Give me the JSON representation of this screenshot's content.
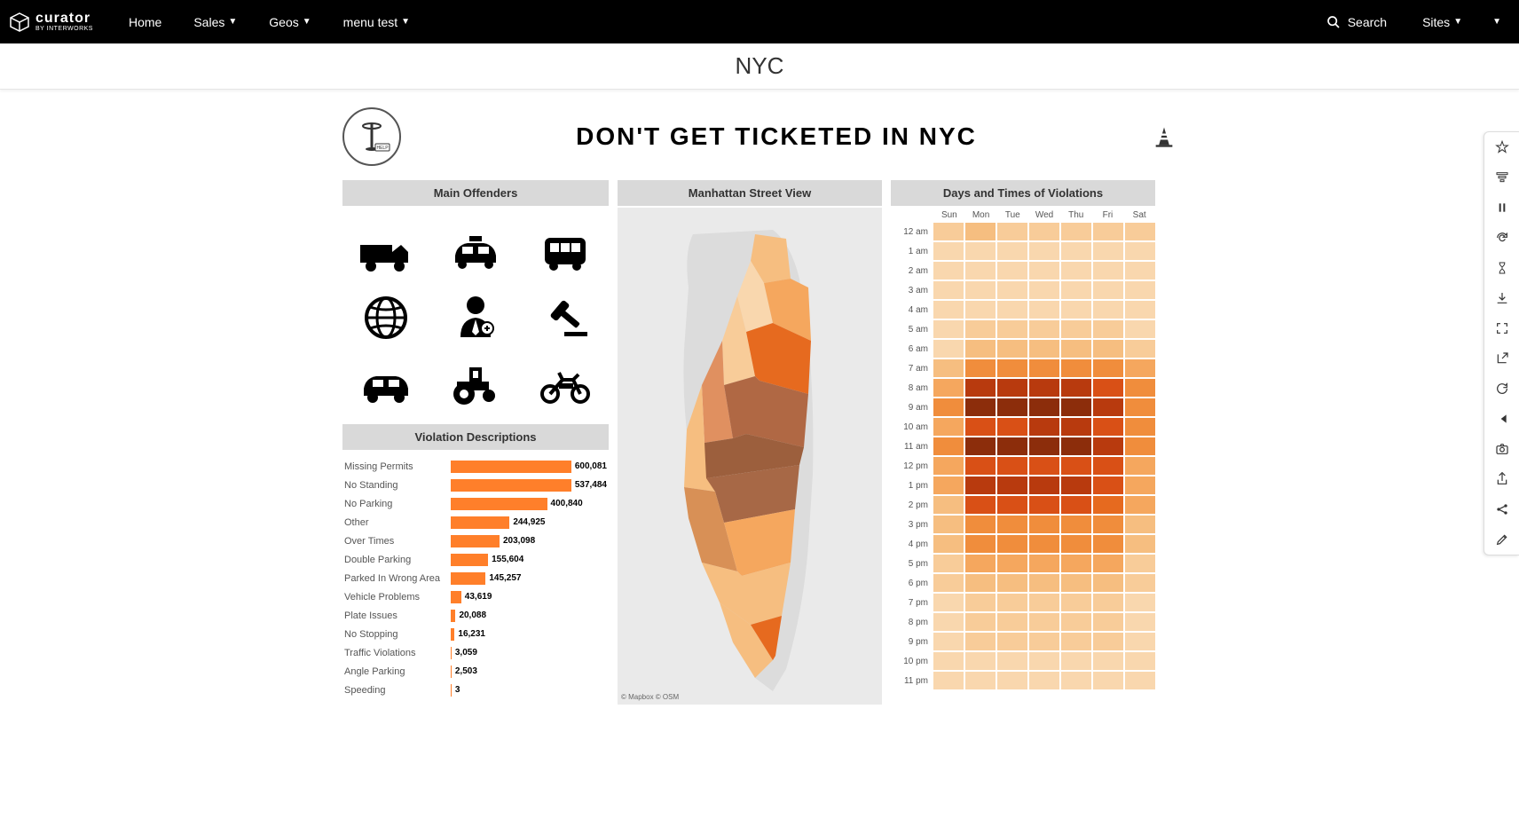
{
  "nav": {
    "brand_main": "curator",
    "brand_sub": "BY INTERWORKS",
    "items": [
      "Home",
      "Sales",
      "Geos",
      "menu test"
    ],
    "items_dropdown": [
      false,
      true,
      true,
      true
    ],
    "search_label": "Search",
    "sites_label": "Sites"
  },
  "page_title": "NYC",
  "dash_title": "DON'T GET TICKETED IN NYC",
  "panels": {
    "offenders": "Main Offenders",
    "map": "Manhattan Street View",
    "heatmap": "Days and Times of Violations",
    "violations": "Violation Descriptions"
  },
  "offenders": [
    "truck",
    "taxi",
    "bus",
    "globe",
    "official",
    "gavel",
    "car",
    "tractor",
    "motorcycle"
  ],
  "map_attrib": "© Mapbox  © OSM",
  "chart_data": {
    "violations_bar": {
      "type": "bar",
      "title": "Violation Descriptions",
      "xlabel": "",
      "ylabel": "",
      "categories": [
        "Missing Permits",
        "No Standing",
        "No Parking",
        "Other",
        "Over Times",
        "Double Parking",
        "Parked In Wrong Area",
        "Vehicle Problems",
        "Plate Issues",
        "No Stopping",
        "Traffic Violations",
        "Angle Parking",
        "Speeding"
      ],
      "values": [
        600081,
        537484,
        400840,
        244925,
        203098,
        155604,
        145257,
        43619,
        20088,
        16231,
        3059,
        2503,
        3
      ],
      "value_labels": [
        "600,081",
        "537,484",
        "400,840",
        "244,925",
        "203,098",
        "155,604",
        "145,257",
        "43,619",
        "20,088",
        "16,231",
        "3,059",
        "2,503",
        "3"
      ],
      "xmax": 650000
    },
    "heatmap": {
      "type": "heatmap",
      "title": "Days and Times of Violations",
      "days": [
        "Sun",
        "Mon",
        "Tue",
        "Wed",
        "Thu",
        "Fri",
        "Sat"
      ],
      "hours": [
        "12 am",
        "1 am",
        "2 am",
        "3 am",
        "4 am",
        "5 am",
        "6 am",
        "7 am",
        "8 am",
        "9 am",
        "10 am",
        "11 am",
        "12 pm",
        "1 pm",
        "2 pm",
        "3 pm",
        "4 pm",
        "5 pm",
        "6 pm",
        "7 pm",
        "8 pm",
        "9 pm",
        "10 pm",
        "11 pm"
      ],
      "intensity": [
        [
          3,
          4,
          3,
          3,
          3,
          3,
          3
        ],
        [
          2,
          2,
          2,
          2,
          2,
          2,
          2
        ],
        [
          2,
          2,
          2,
          2,
          2,
          2,
          2
        ],
        [
          2,
          2,
          2,
          2,
          2,
          2,
          2
        ],
        [
          2,
          2,
          2,
          2,
          2,
          2,
          2
        ],
        [
          2,
          3,
          3,
          3,
          3,
          3,
          2
        ],
        [
          2,
          4,
          4,
          4,
          4,
          4,
          3
        ],
        [
          4,
          6,
          6,
          6,
          6,
          6,
          5
        ],
        [
          5,
          9,
          9,
          9,
          9,
          8,
          6
        ],
        [
          6,
          10,
          10,
          10,
          10,
          9,
          6
        ],
        [
          5,
          8,
          8,
          9,
          9,
          8,
          6
        ],
        [
          6,
          10,
          10,
          10,
          10,
          9,
          6
        ],
        [
          5,
          8,
          8,
          8,
          8,
          8,
          5
        ],
        [
          5,
          9,
          9,
          9,
          9,
          8,
          5
        ],
        [
          4,
          8,
          8,
          8,
          8,
          7,
          5
        ],
        [
          4,
          6,
          6,
          6,
          6,
          6,
          4
        ],
        [
          4,
          6,
          6,
          6,
          6,
          6,
          4
        ],
        [
          3,
          5,
          5,
          5,
          5,
          5,
          3
        ],
        [
          3,
          4,
          4,
          4,
          4,
          4,
          3
        ],
        [
          2,
          3,
          3,
          3,
          3,
          3,
          2
        ],
        [
          2,
          3,
          3,
          3,
          3,
          3,
          2
        ],
        [
          2,
          3,
          3,
          3,
          3,
          3,
          2
        ],
        [
          2,
          2,
          2,
          2,
          2,
          2,
          2
        ],
        [
          2,
          2,
          2,
          2,
          2,
          2,
          2
        ]
      ],
      "colors": [
        "#fce9d4",
        "#f9d7ae",
        "#f8cc99",
        "#f6be80",
        "#f5a75e",
        "#f08d3c",
        "#e66a1f",
        "#d95016",
        "#b83a0e",
        "#8c2d0b"
      ]
    }
  },
  "sidebar_icons": [
    "star",
    "filter",
    "pause",
    "refresh",
    "hourglass",
    "download",
    "fullscreen",
    "export",
    "reload",
    "skip-back",
    "camera",
    "share-out",
    "share",
    "edit"
  ]
}
